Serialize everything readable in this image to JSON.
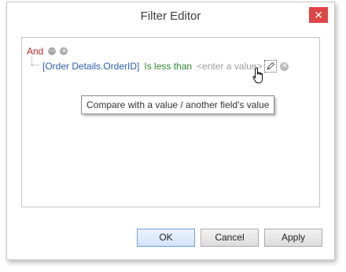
{
  "window": {
    "title": "Filter Editor",
    "close_glyph": "✕"
  },
  "filter": {
    "group_operator": "And",
    "group_options_icon": "ellipsis-circle-icon",
    "add_condition_icon": "plus-circle-icon",
    "condition": {
      "field": "[Order Details.OrderID]",
      "operator": "Is less than",
      "value_placeholder": "<enter a value>",
      "edit_icon": "pencil-icon",
      "remove_icon": "remove-circle-icon"
    }
  },
  "tooltip": {
    "text": "Compare with a value / another field's value"
  },
  "buttons": {
    "ok": "OK",
    "cancel": "Cancel",
    "apply": "Apply"
  },
  "colors": {
    "group_operator": "#b42424",
    "field": "#2b5db5",
    "operator": "#2a8a2a",
    "value_placeholder": "#9c9c9c",
    "close_button": "#e04343"
  }
}
